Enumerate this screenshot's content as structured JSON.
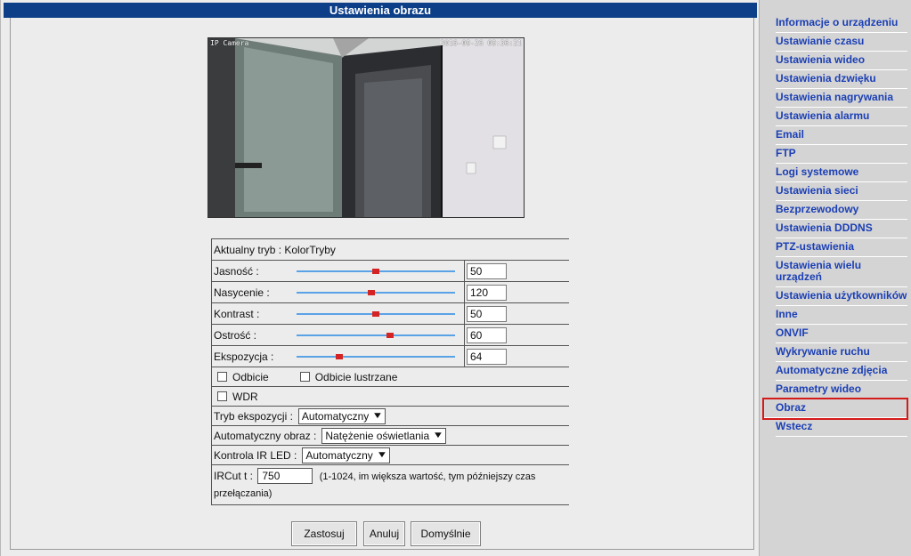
{
  "page": {
    "title": "Ustawienia obrazu"
  },
  "preview": {
    "osd_left": "IP Camera",
    "osd_right": "2016-09-26 09:36:21"
  },
  "settings": {
    "mode_text": "Aktualny tryb : KolorTryby",
    "sliders": [
      {
        "label": "Jasność :",
        "value": "50",
        "fraction": 0.5
      },
      {
        "label": "Nasycenie :",
        "value": "120",
        "fraction": 0.47
      },
      {
        "label": "Kontrast :",
        "value": "50",
        "fraction": 0.5
      },
      {
        "label": "Ostrość :",
        "value": "60",
        "fraction": 0.59
      },
      {
        "label": "Ekspozycja :",
        "value": "64",
        "fraction": 0.27
      }
    ],
    "flip_label": "Odbicie",
    "mirror_label": "Odbicie lustrzane",
    "wdr_label": "WDR",
    "exposure_mode_label": "Tryb ekspozycji :",
    "exposure_mode_value": "Automatyczny",
    "auto_image_label": "Automatyczny obraz :",
    "auto_image_value": "Natężenie oświetlania",
    "ir_led_label": "Kontrola IR LED :",
    "ir_led_value": "Automatyczny",
    "ircut_label": "IRCut t :",
    "ircut_value": "750",
    "ircut_hint_1": "(1-1024, im większa wartość, tym później",
    "ircut_hint_word": "szy czas",
    "ircut_hint_2": "przełączania)"
  },
  "buttons": {
    "apply": "Zastosuj",
    "cancel": "Anuluj",
    "default": "Domyślnie"
  },
  "sidebar": {
    "items": [
      "Informacje o urządzeniu",
      "Ustawianie czasu",
      "Ustawienia wideo",
      "Ustawienia dzwięku",
      "Ustawienia nagrywania",
      "Ustawienia alarmu",
      "Email",
      "FTP",
      "Logi systemowe",
      "Ustawienia sieci",
      "Bezprzewodowy",
      "Ustawienia DDDNS",
      "PTZ-ustawienia",
      "Ustawienia wielu urządzeń",
      "Ustawienia użytkowników",
      "Inne",
      "ONVIF",
      "Wykrywanie ruchu",
      "Automatyczne zdjęcia",
      "Parametry wideo",
      "Obraz",
      "Wstecz"
    ],
    "highlighted": "Obraz"
  }
}
